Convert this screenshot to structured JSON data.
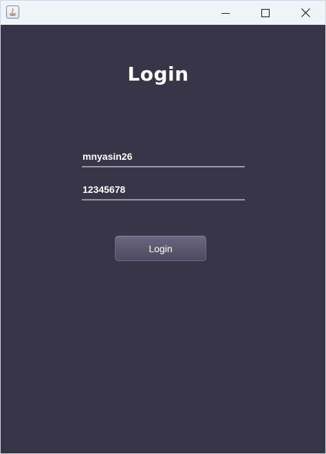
{
  "window": {
    "icon": "java-app-icon",
    "controls": {
      "minimize": "minimize-icon",
      "maximize": "maximize-icon",
      "close": "close-icon"
    }
  },
  "form": {
    "title": "Login",
    "username_value": "mnyasin26",
    "password_value": "12345678",
    "login_label": "Login"
  },
  "colors": {
    "background": "#383548",
    "titlebar": "#eff4f9",
    "text": "#ffffff",
    "underline": "#9b98ab",
    "button": "#5b586f"
  }
}
